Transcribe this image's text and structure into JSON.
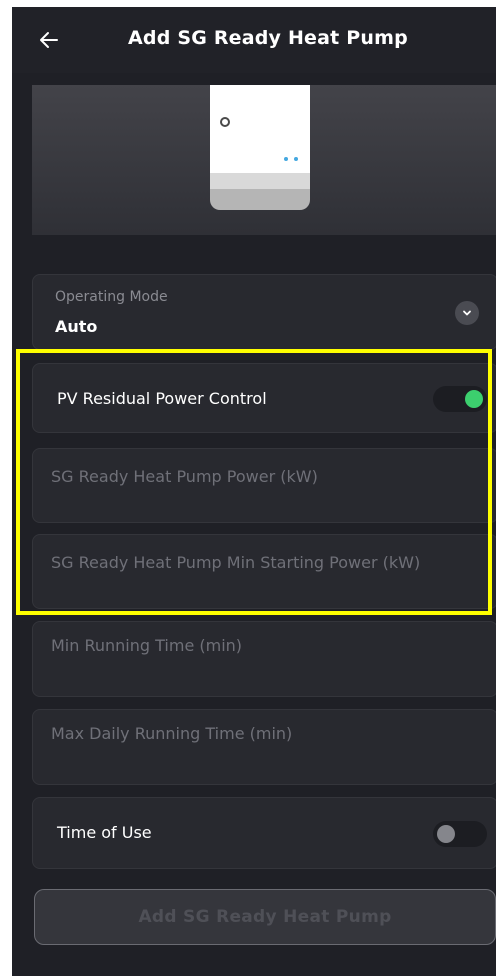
{
  "header": {
    "back_icon": "arrow-left-icon",
    "title": "Add SG Ready Heat Pump"
  },
  "device_image": {
    "icon": "heat-pump-device-illustration"
  },
  "operating_mode": {
    "label": "Operating Mode",
    "value": "Auto",
    "icon": "chevron-down-icon"
  },
  "pv_residual_power_control": {
    "label": "PV Residual Power Control",
    "enabled": true
  },
  "fields": {
    "heat_pump_power": {
      "placeholder": "SG Ready Heat Pump Power (kW)"
    },
    "min_starting_power": {
      "placeholder": "SG Ready Heat Pump Min Starting Power (kW)"
    },
    "min_running_time": {
      "placeholder": "Min Running Time (min)"
    },
    "max_daily_running_time": {
      "placeholder": "Max Daily Running Time (min)"
    }
  },
  "time_of_use": {
    "label": "Time of Use",
    "enabled": false
  },
  "submit": {
    "label": "Add SG Ready Heat Pump"
  },
  "colors": {
    "background": "#1f2026",
    "card": "#28292f",
    "toggle_on": "#3ccf6e",
    "toggle_off": "#85868c",
    "highlight": "#ffff00"
  }
}
